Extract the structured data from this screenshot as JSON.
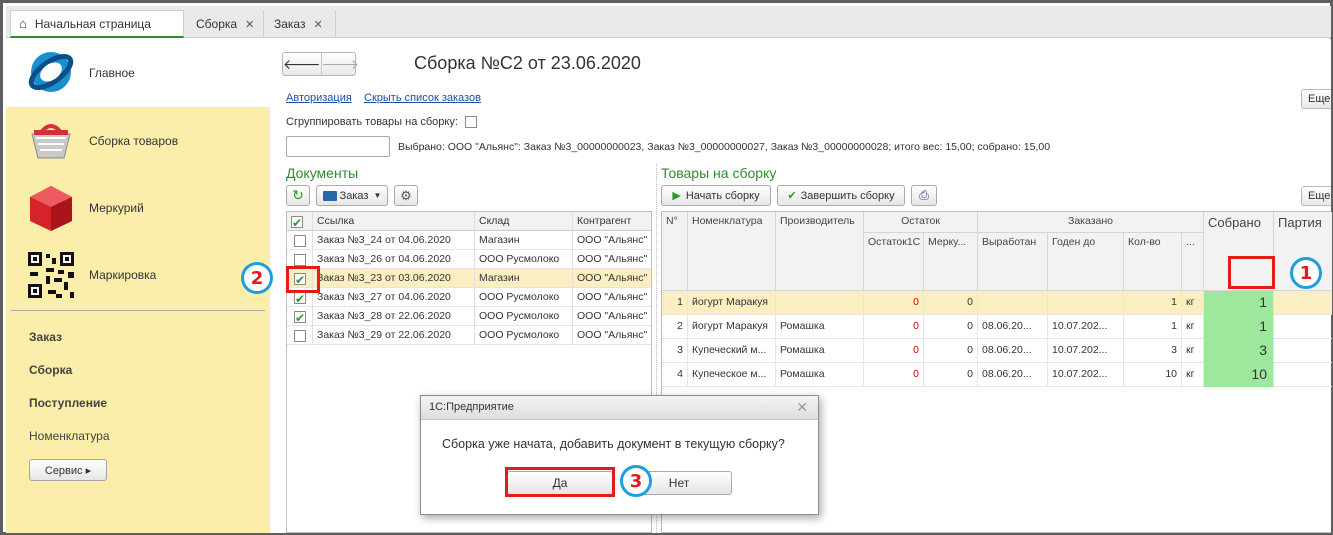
{
  "tabs": [
    {
      "label": "Начальная страница"
    },
    {
      "label": "Сборка"
    },
    {
      "label": "Заказ"
    }
  ],
  "sidebar": {
    "sections": [
      {
        "label": "Главное",
        "icon": "globe-logo-icon"
      },
      {
        "label": "Сборка товаров",
        "icon": "basket-icon"
      },
      {
        "label": "Меркурий",
        "icon": "red-cube-icon"
      },
      {
        "label": "Маркировка",
        "icon": "qr-code-icon"
      }
    ],
    "links": [
      "Заказ",
      "Сборка",
      "Поступление",
      "Номенклатура"
    ],
    "service_label": "Сервис ▸"
  },
  "header": {
    "back_label": "🡐",
    "forward_label": "🡒",
    "title": "Сборка №С2 от 23.06.2020",
    "auth_link": "Авторизация",
    "hide_link": "Скрыть список  заказов",
    "more_label": "Еще",
    "group_label": "Сгруппировать товары на сборку:",
    "selected_info": "Выбрано: ООО \"Альянс\": Заказ №3_00000000023, Заказ №3_00000000027, Заказ №3_00000000028; итого вес: 15,00; собрано: 15,00"
  },
  "documents": {
    "title": "Документы",
    "order_btn": "Заказ",
    "columns": [
      "Ссылка",
      "Склад",
      "Контрагент"
    ],
    "rows": [
      {
        "checked": false,
        "link": "Заказ №3_24 от 04.06.2020",
        "warehouse": "Магазин",
        "contractor": "ООО \"Альянс\""
      },
      {
        "checked": false,
        "link": "Заказ №3_26 от 04.06.2020",
        "warehouse": "ООО Русмолоко",
        "contractor": "ООО \"Альянс\""
      },
      {
        "checked": true,
        "link": "Заказ №3_23 от 03.06.2020",
        "warehouse": "Магазин",
        "contractor": "ООО \"Альянс\""
      },
      {
        "checked": true,
        "link": "Заказ №3_27 от 04.06.2020",
        "warehouse": "ООО Русмолоко",
        "contractor": "ООО \"Альянс\""
      },
      {
        "checked": true,
        "link": "Заказ №3_28 от 22.06.2020",
        "warehouse": "ООО Русмолоко",
        "contractor": "ООО \"Альянс\""
      },
      {
        "checked": false,
        "link": "Заказ №3_29 от 22.06.2020",
        "warehouse": "ООО Русмолоко",
        "contractor": "ООО \"Альянс\""
      }
    ]
  },
  "goods": {
    "title": "Товары на сборку",
    "start_btn": "Начать сборку",
    "finish_btn": "Завершить сборку",
    "more_label": "Еще",
    "headers": {
      "num": "N°",
      "nomenclature": "Номенклатура",
      "producer": "Производитель",
      "remainder": "Остаток",
      "rem1c": "Остаток1С",
      "mercury": "Мерку...",
      "ordered": "Заказано",
      "produced": "Выработан",
      "valid": "Годен до",
      "qty": "Кол-во",
      "unit": "...",
      "collected": "Собрано",
      "batch": "Партия"
    },
    "rows": [
      {
        "n": "1",
        "name": "йогурт Маракуя",
        "producer": "",
        "rem1c": "0",
        "merc": "0",
        "produced": "",
        "valid": "",
        "qty": "1",
        "unit": "кг",
        "collected": "1"
      },
      {
        "n": "2",
        "name": "йогурт Маракуя",
        "producer": "Ромашка",
        "rem1c": "0",
        "merc": "0",
        "produced": "08.06.20...",
        "valid": "10.07.202...",
        "qty": "1",
        "unit": "кг",
        "collected": "1"
      },
      {
        "n": "3",
        "name": "Купеческий м...",
        "producer": "Ромашка",
        "rem1c": "0",
        "merc": "0",
        "produced": "08.06.20...",
        "valid": "10.07.202...",
        "qty": "3",
        "unit": "кг",
        "collected": "3"
      },
      {
        "n": "4",
        "name": "Купеческое м...",
        "producer": "Ромашка",
        "rem1c": "0",
        "merc": "0",
        "produced": "08.06.20...",
        "valid": "10.07.202...",
        "qty": "10",
        "unit": "кг",
        "collected": "10"
      }
    ]
  },
  "dialog": {
    "title": "1С:Предприятие",
    "message": "Сборка уже начата, добавить документ в текущую сборку?",
    "yes": "Да",
    "no": "Нет"
  },
  "annotations": [
    "1",
    "2",
    "3"
  ],
  "colors": {
    "accent_green": "#2e8b2e",
    "highlight": "#fbeec0",
    "sidebar": "#fbedaa",
    "annotation_red": "#e21b1b",
    "annotation_blue": "#1c9ee0"
  }
}
